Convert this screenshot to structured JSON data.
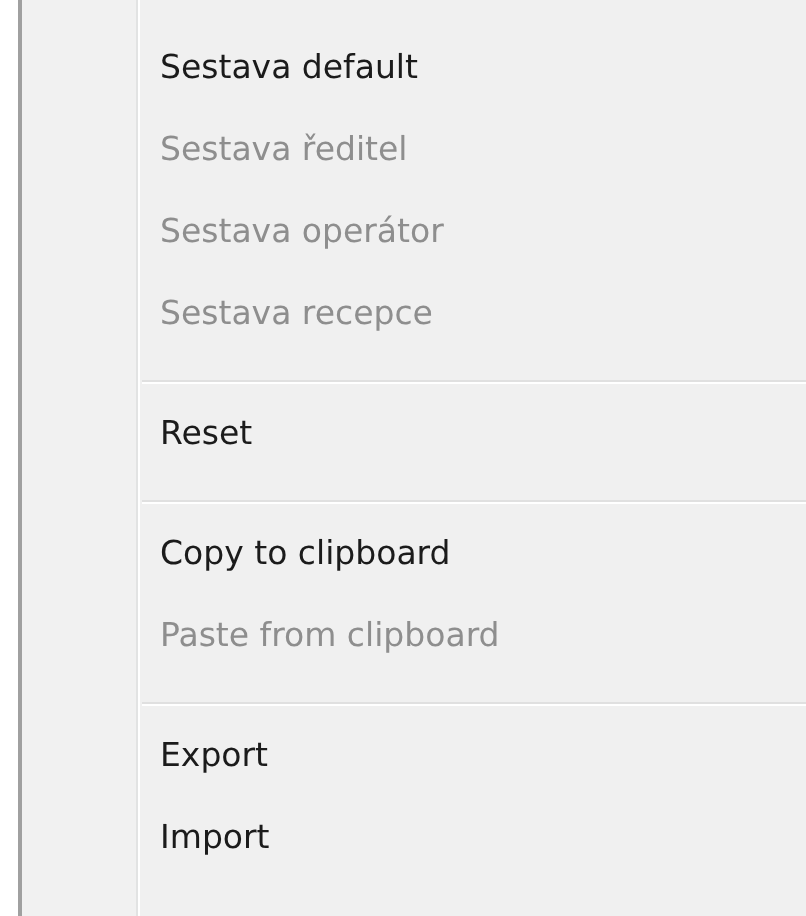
{
  "menu": {
    "items": [
      {
        "kind": "item",
        "label": "Sestava default",
        "disabled": false
      },
      {
        "kind": "item",
        "label": "Sestava ředitel",
        "disabled": true
      },
      {
        "kind": "item",
        "label": "Sestava operátor",
        "disabled": true
      },
      {
        "kind": "item",
        "label": "Sestava recepce",
        "disabled": true
      },
      {
        "kind": "separator"
      },
      {
        "kind": "item",
        "label": "Reset",
        "disabled": false
      },
      {
        "kind": "separator"
      },
      {
        "kind": "item",
        "label": "Copy to clipboard",
        "disabled": false
      },
      {
        "kind": "item",
        "label": "Paste from clipboard",
        "disabled": true
      },
      {
        "kind": "separator"
      },
      {
        "kind": "item",
        "label": "Export",
        "disabled": false
      },
      {
        "kind": "item",
        "label": "Import",
        "disabled": false
      }
    ]
  }
}
